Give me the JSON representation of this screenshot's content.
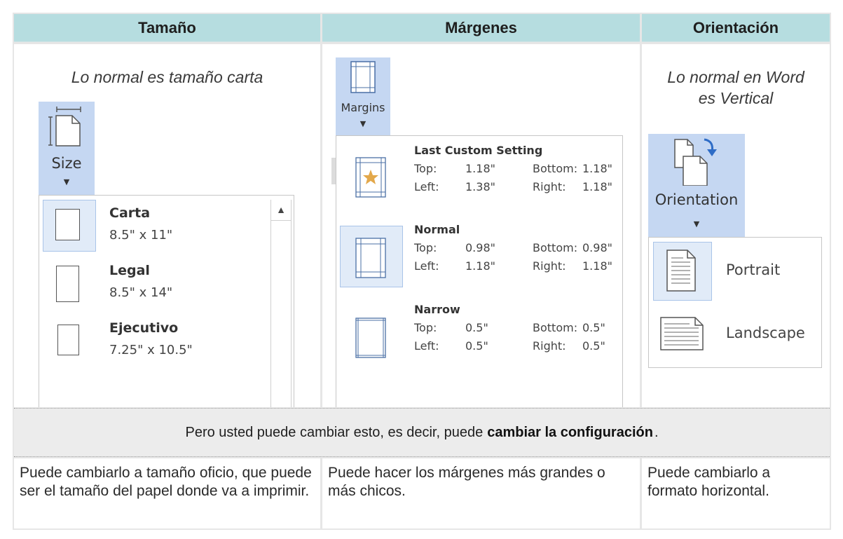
{
  "headers": {
    "size": "Tamaño",
    "margins": "Márgenes",
    "orientation": "Orientación"
  },
  "size_col": {
    "note": "Lo normal es tamaño carta",
    "button_label": "Size",
    "items": [
      {
        "name": "Carta",
        "dims": "8.5\" x 11\"",
        "selected": true
      },
      {
        "name": "Legal",
        "dims": "8.5\" x 14\""
      },
      {
        "name": "Ejecutivo",
        "dims": "7.25\" x 10.5\""
      }
    ]
  },
  "margins_col": {
    "button_label": "Margins",
    "items": [
      {
        "name": "Last Custom Setting",
        "top_label": "Top:",
        "top": "1.18\"",
        "bottom_label": "Bottom:",
        "bottom": "1.18\"",
        "left_label": "Left:",
        "left": "1.38\"",
        "right_label": "Right:",
        "right": "1.18\""
      },
      {
        "name": "Normal",
        "top_label": "Top:",
        "top": "0.98\"",
        "bottom_label": "Bottom:",
        "bottom": "0.98\"",
        "left_label": "Left:",
        "left": "1.18\"",
        "right_label": "Right:",
        "right": "1.18\"",
        "selected": true
      },
      {
        "name": "Narrow",
        "top_label": "Top:",
        "top": "0.5\"",
        "bottom_label": "Bottom:",
        "bottom": "0.5\"",
        "left_label": "Left:",
        "left": "0.5\"",
        "right_label": "Right:",
        "right": "0.5\""
      }
    ]
  },
  "orientation_col": {
    "note_line1": "Lo normal en Word",
    "note_line2": "es Vertical",
    "button_label": "Orientation",
    "items": [
      {
        "name": "Portrait",
        "selected": true
      },
      {
        "name": "Landscape"
      }
    ]
  },
  "middle": {
    "text_before": "Pero usted puede cambiar esto, es decir, puede",
    "text_bold": "cambiar la configuración",
    "text_after": "."
  },
  "bottom": {
    "size_text": "Puede cambiarlo a tamaño oficio, que puede ser el tamaño del papel donde va a imprimir.",
    "margins_text": "Puede hacer los márgenes más grandes o más chicos.",
    "orientation_text": "Puede cambiarlo a formato horizontal."
  },
  "colors": {
    "header_bg": "#b6dde0",
    "ribbon_button_bg": "#c5d7f2",
    "selection_bg": "#e1ebf8",
    "star": "#e3a84a"
  }
}
